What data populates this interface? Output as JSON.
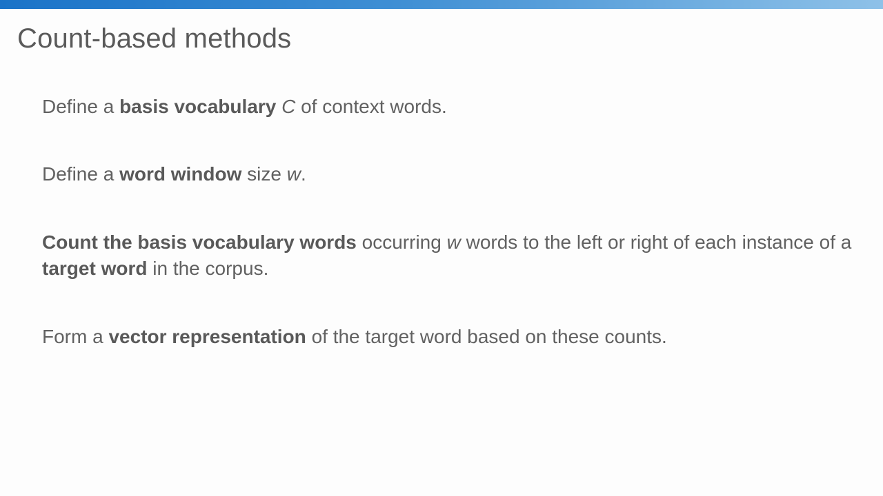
{
  "slide": {
    "title": "Count-based methods",
    "accent_bar_colors": [
      "#1a73c8",
      "#3f8fd4",
      "#8ec1e8"
    ]
  },
  "bullets": [
    {
      "parts": [
        {
          "text": "Define a ",
          "style": "normal"
        },
        {
          "text": "basis vocabulary",
          "style": "bold"
        },
        {
          "text": " ",
          "style": "normal"
        },
        {
          "text": "C",
          "style": "italic"
        },
        {
          "text": " of context words.",
          "style": "normal"
        }
      ]
    },
    {
      "parts": [
        {
          "text": "Define a ",
          "style": "normal"
        },
        {
          "text": "word window",
          "style": "bold"
        },
        {
          "text": " size ",
          "style": "normal"
        },
        {
          "text": "w",
          "style": "italic"
        },
        {
          "text": ".",
          "style": "normal"
        }
      ]
    },
    {
      "parts": [
        {
          "text": "Count the basis vocabulary words",
          "style": "bold"
        },
        {
          "text": " occurring ",
          "style": "normal"
        },
        {
          "text": "w",
          "style": "italic"
        },
        {
          "text": " words to the left or right of each instance of a ",
          "style": "normal"
        },
        {
          "text": "target word",
          "style": "bold"
        },
        {
          "text": " in the corpus.",
          "style": "normal"
        }
      ]
    },
    {
      "parts": [
        {
          "text": "Form a ",
          "style": "normal"
        },
        {
          "text": "vector representation",
          "style": "bold"
        },
        {
          "text": " of the target word based on these counts.",
          "style": "normal"
        }
      ]
    }
  ]
}
